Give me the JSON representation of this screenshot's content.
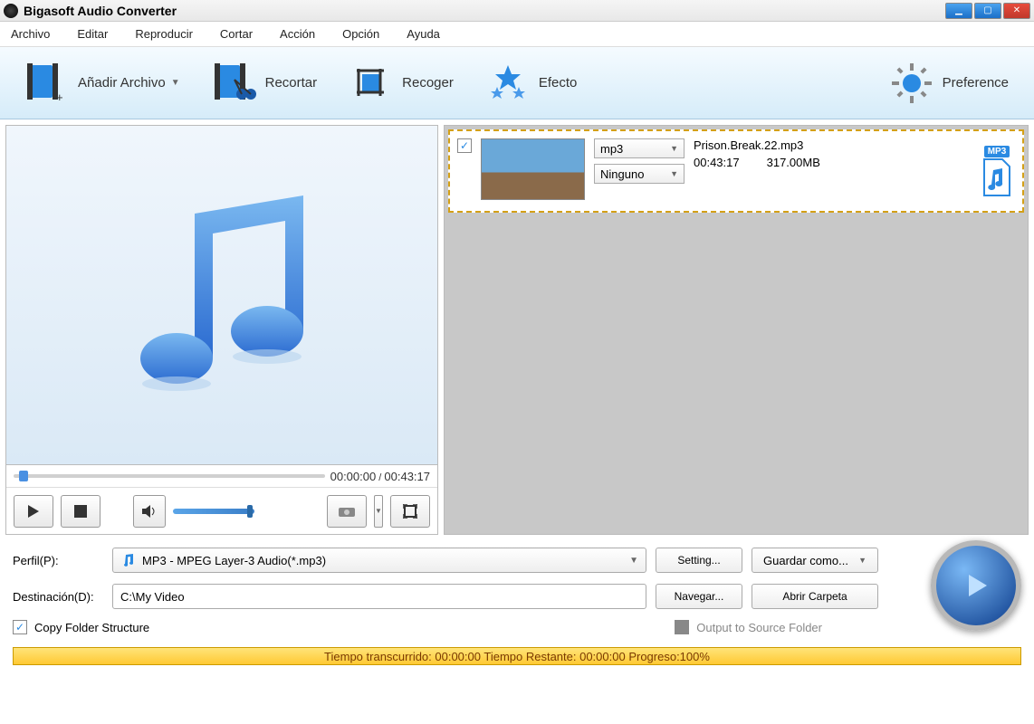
{
  "app": {
    "title": "Bigasoft Audio Converter"
  },
  "menu": {
    "items": [
      "Archivo",
      "Editar",
      "Reproducir",
      "Cortar",
      "Acción",
      "Opción",
      "Ayuda"
    ]
  },
  "toolbar": {
    "add": "Añadir Archivo",
    "trim": "Recortar",
    "crop": "Recoger",
    "effect": "Efecto",
    "pref": "Preference"
  },
  "preview": {
    "time_current": "00:00:00",
    "time_total": "00:43:17"
  },
  "file": {
    "name": "Prison.Break.22.mp3",
    "duration": "00:43:17",
    "size": "317.00MB",
    "format_dd": "mp3",
    "effect_dd": "Ninguno",
    "badge": "MP3"
  },
  "profile": {
    "label": "Perfil(P):",
    "value": "MP3 - MPEG Layer-3 Audio(*.mp3)",
    "setting": "Setting...",
    "saveas": "Guardar como..."
  },
  "dest": {
    "label": "Destinación(D):",
    "path": "C:\\My Video",
    "browse": "Navegar...",
    "open": "Abrir Carpeta"
  },
  "options": {
    "copy_structure": "Copy Folder Structure",
    "output_source": "Output to Source Folder"
  },
  "footer": "Tiempo transcurrido: 00:00:00 Tiempo Restante: 00:00:00 Progreso:100%"
}
